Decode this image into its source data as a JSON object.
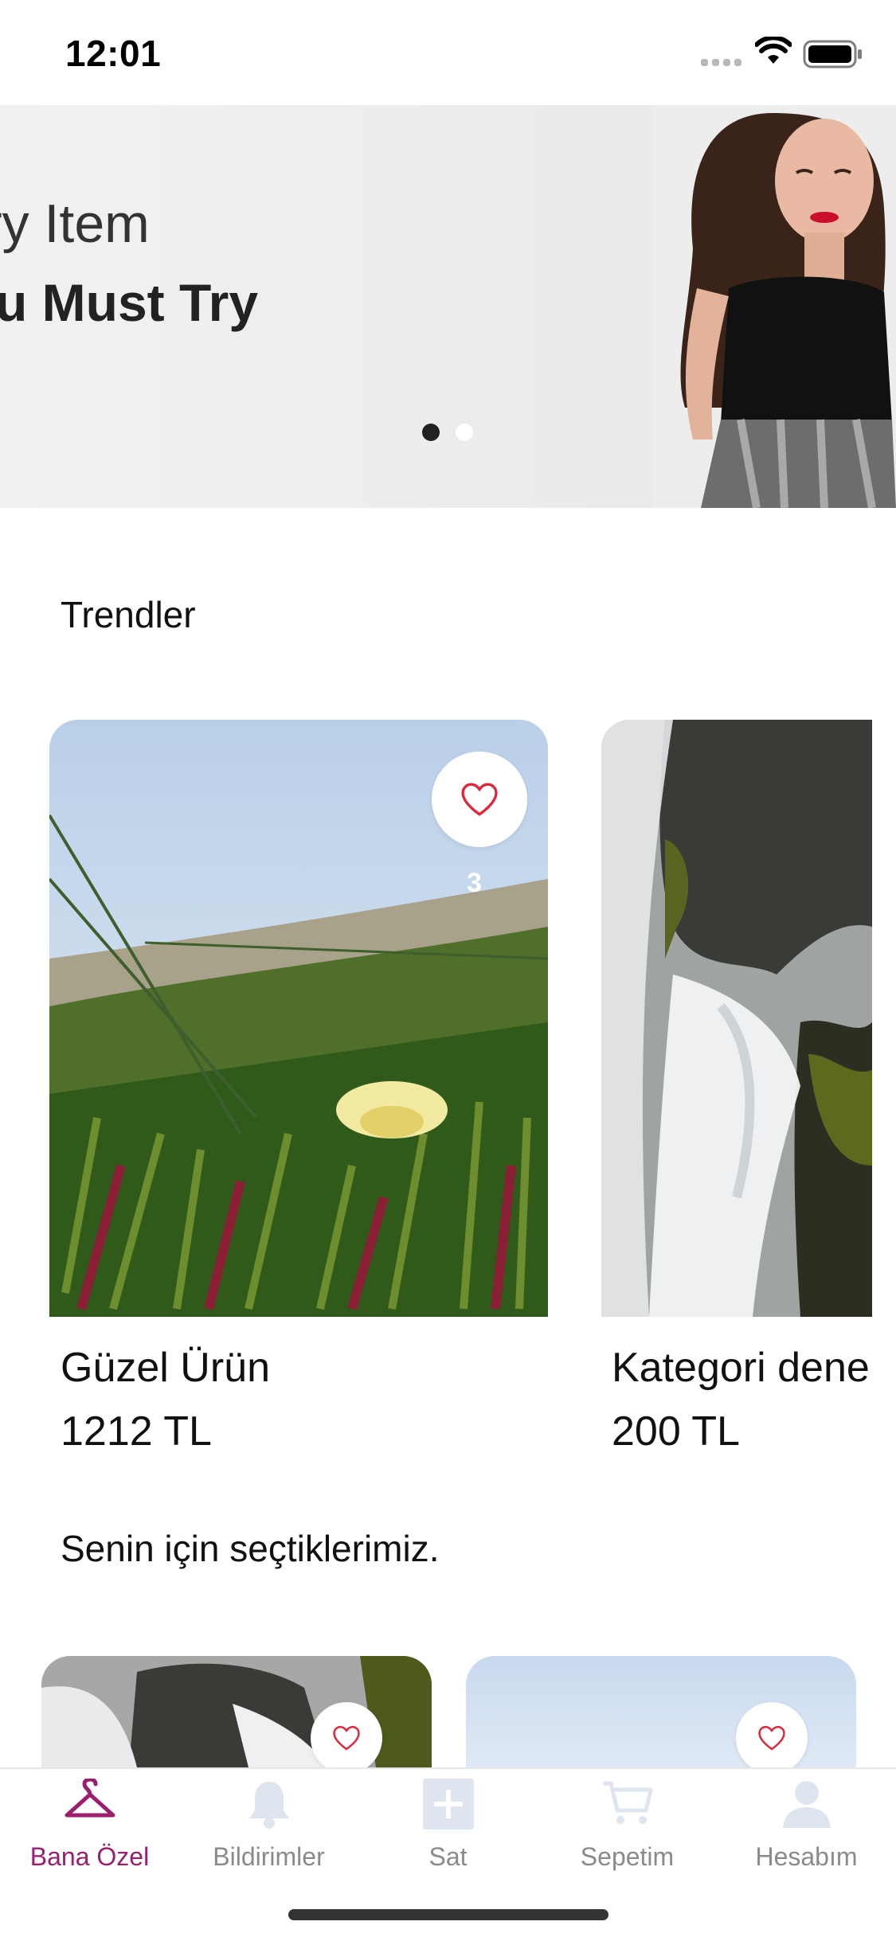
{
  "status_bar": {
    "time": "12:01"
  },
  "banner": {
    "line1": "ry Item",
    "line2": "u Must Try",
    "active_slide": 1,
    "slide_count": 2
  },
  "sections": {
    "trends_title": "Trendler",
    "picks_title": "Senin için seçtiklerimiz."
  },
  "trend_products": [
    {
      "name": "Güzel Ürün",
      "price": "1212 TL",
      "likes": "3",
      "icon": "heart-icon"
    },
    {
      "name": "Kategori dene",
      "price": "200 TL"
    }
  ],
  "tab_bar": {
    "active": "Bana Özel",
    "accent_color": "#9c1f6e",
    "tabs": [
      {
        "label": "Bana Özel",
        "icon": "hanger-icon"
      },
      {
        "label": "Bildirimler",
        "icon": "bell-icon"
      },
      {
        "label": "Sat",
        "icon": "plus-square-icon"
      },
      {
        "label": "Sepetim",
        "icon": "cart-icon"
      },
      {
        "label": "Hesabım",
        "icon": "user-icon"
      }
    ]
  }
}
